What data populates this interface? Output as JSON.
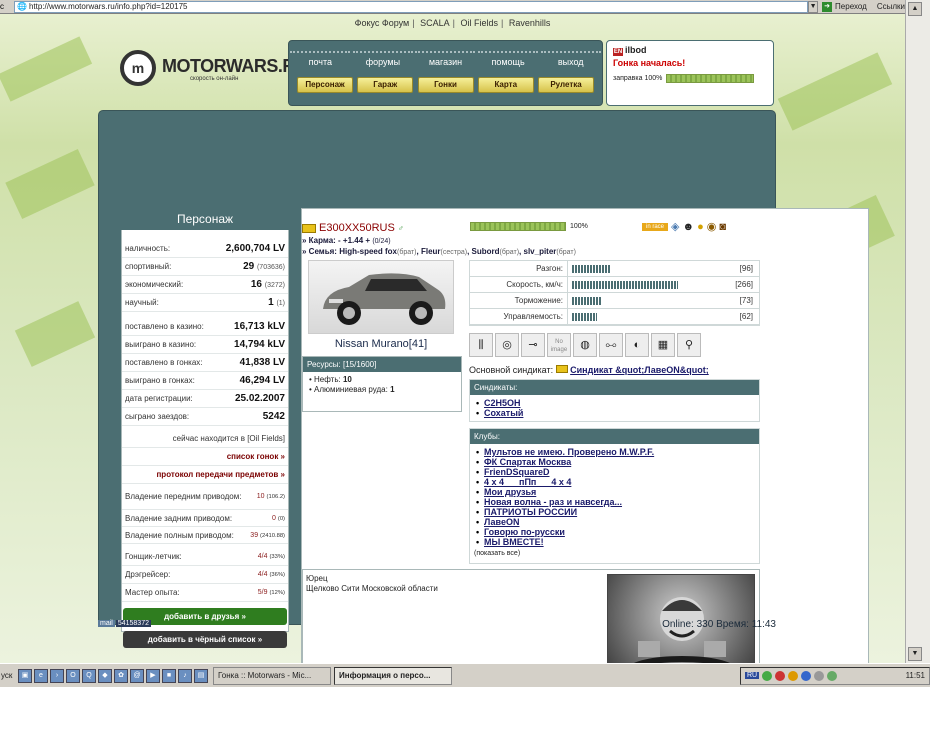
{
  "browser": {
    "url": "http://www.motorwars.ru/info.php?id=120175",
    "go_label": "Переход",
    "links_label": "Ссылки"
  },
  "topnav": [
    "Фокус Форум",
    "SCALA",
    "Oil Fields",
    "Ravenhills"
  ],
  "logo": {
    "title": "MOTORWARS.RU",
    "subtitle": "скорость он-лайн"
  },
  "menu": {
    "top": [
      "почта",
      "форумы",
      "магазин",
      "помощь",
      "выход"
    ],
    "bottom": [
      "Персонаж",
      "Гараж",
      "Гонки",
      "Карта",
      "Рулетка"
    ]
  },
  "user": {
    "flag": "EN",
    "name": "ilbod",
    "status": "Гонка началась!",
    "fuel_label": "заправка 100%",
    "fuel_level": 1.0
  },
  "left": {
    "title": "Персонаж",
    "money": [
      {
        "k": "наличность:",
        "v": "2,600,704 LV"
      },
      {
        "k": "спортивный:",
        "v": "29",
        "s": "(703636)"
      },
      {
        "k": "экономический:",
        "v": "16",
        "s": "(3272)"
      },
      {
        "k": "научный:",
        "v": "1",
        "s": "(1)"
      }
    ],
    "stats": [
      {
        "k": "поставлено в казино:",
        "v": "16,713 kLV"
      },
      {
        "k": "выиграно в казино:",
        "v": "14,794 kLV"
      },
      {
        "k": "поставлено в гонках:",
        "v": "41,838 LV"
      },
      {
        "k": "выиграно в гонках:",
        "v": "46,294 LV"
      },
      {
        "k": "дата регистрации:",
        "v": "25.02.2007"
      },
      {
        "k": "сыграно заездов:",
        "v": "5242"
      }
    ],
    "location": "сейчас находится в [Oil Fields]",
    "races_link": "список гонок »",
    "transfer_link": "протокол передачи предметов »",
    "drive": [
      {
        "k": "Владение передним приводом:",
        "v": "10",
        "s": "(106.2)"
      },
      {
        "k": "Владение задним приводом:",
        "v": "0",
        "s": "(0)"
      },
      {
        "k": "Владение полным приводом:",
        "v": "39",
        "s": "(2410.88)"
      }
    ],
    "ranks": [
      {
        "k": "Гонщик-летчик:",
        "v": "4/4",
        "s": "(33%)"
      },
      {
        "k": "Дрэгрейсер:",
        "v": "4/4",
        "s": "(36%)"
      },
      {
        "k": "Мастер опыта:",
        "v": "5/9",
        "s": "(12%)"
      }
    ],
    "add_friend": "добавить в друзья »",
    "add_black": "добавить в чёрный список »"
  },
  "car": {
    "plate": "E300XX50RUS",
    "progress_label": "100%",
    "progress": 1.0,
    "karma_label": "» Карма:",
    "karma_value": "- +1.44 +",
    "karma_count": "(0/24)",
    "family_label": "» Семья:",
    "family": [
      {
        "name": "High-speed fox",
        "rel": "(брат)"
      },
      {
        "name": "Fleur",
        "rel": "(сестра)"
      },
      {
        "name": "Subord",
        "rel": "(брат)"
      },
      {
        "name": "slv_piter",
        "rel": "(брат)"
      }
    ],
    "model": "Nissan Murano[41]",
    "resources_title": "Ресурсы: [15/1600]",
    "resources": [
      {
        "k": "Нефть:",
        "v": "10"
      },
      {
        "k": "Алюминиевая руда:",
        "v": "1"
      }
    ],
    "perf": [
      {
        "k": "Разгон:",
        "v": "[96]",
        "level": 96
      },
      {
        "k": "Скорость, км/ч:",
        "v": "[266]",
        "level": 266
      },
      {
        "k": "Торможение:",
        "v": "[73]",
        "level": 73
      },
      {
        "k": "Управляемость:",
        "v": "[62]",
        "level": 62
      }
    ],
    "syndicate_label": "Основной синдикат:",
    "syndicate": "Синдикат &quot;ЛавеON&quot;",
    "icons": [
      "shock-absorber-icon",
      "tire-icon",
      "exhaust-icon",
      "no-image-icon",
      "brake-disc-icon",
      "suspension-icon",
      "turbo-icon",
      "ecu-icon",
      "spark-plug-icon"
    ],
    "no_image": "No image",
    "in_race": "in race"
  },
  "syndicates": {
    "title": "Синдикаты:",
    "items": [
      "C2H5OH",
      "Сохатый"
    ]
  },
  "clubs": {
    "title": "Клубы:",
    "items": [
      "Мультов не имею. Проверено M.W.P.F.",
      "ФК Спартак Москва",
      "FrienDSquareD",
      "4 х 4      пПп      4 х 4",
      "Мои друзья",
      "Новая волна - раз и навсегда...",
      "ПАТРИОТЫ РОССИИ",
      "ЛавеON",
      "Говорю по-русски",
      "МЫ ВМЕСТЕ!"
    ],
    "show_all": "(показать все)"
  },
  "about": {
    "line1": "Юрец",
    "line2": "Щелково Сити Московской области"
  },
  "footer": {
    "counter": "54158372",
    "online": "Online: 330  Время: 11:43"
  },
  "taskbar": {
    "start": "уск",
    "tasks": [
      "Гонка :: Motorwars - Mic...",
      "Информация о персо..."
    ],
    "lang": "RU",
    "clock": "11:51"
  }
}
